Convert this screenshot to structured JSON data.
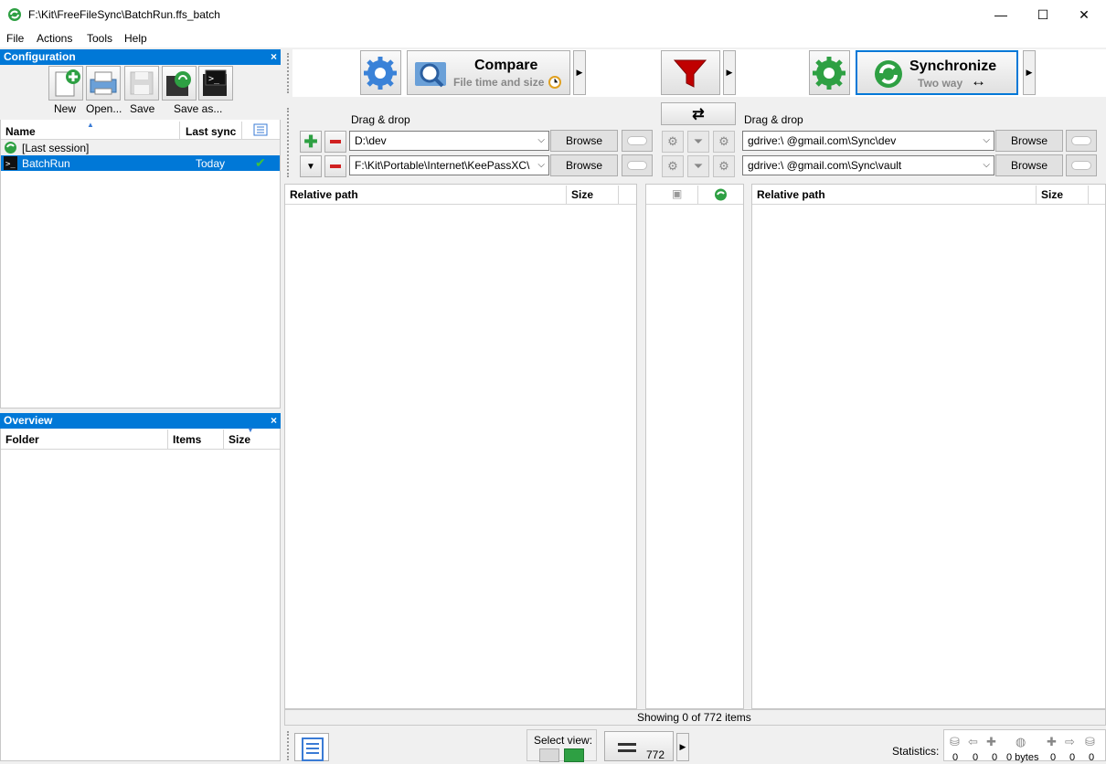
{
  "window": {
    "title": "F:\\Kit\\FreeFileSync\\BatchRun.ffs_batch",
    "minimize": "—",
    "maximize": "☐",
    "close": "✕"
  },
  "menu": [
    "File",
    "Actions",
    "Tools",
    "Help"
  ],
  "config_panel": {
    "title": "Configuration",
    "close": "×",
    "tools": [
      {
        "label": "New",
        "icon": "new-doc-icon"
      },
      {
        "label": "Open...",
        "icon": "open-printer-icon"
      },
      {
        "label": "Save",
        "icon": "save-disk-icon"
      },
      {
        "label": "Save as...",
        "icon": "save-as-icon"
      }
    ],
    "columns": {
      "name": "Name",
      "last_sync": "Last sync"
    },
    "rows": [
      {
        "name": "[Last session]",
        "last_sync": ""
      },
      {
        "name": "BatchRun",
        "last_sync": "Today"
      }
    ]
  },
  "overview_panel": {
    "title": "Overview",
    "close": "×",
    "columns": {
      "folder": "Folder",
      "items": "Items",
      "size": "Size"
    }
  },
  "toolbar": {
    "compare": {
      "label": "Compare",
      "sub": "File time and size"
    },
    "sync": {
      "label": "Synchronize",
      "sub": "Two way",
      "sub_icon": "↔"
    }
  },
  "folders": {
    "drag_left": "Drag & drop",
    "drag_right": "Drag & drop",
    "left": [
      "D:\\dev",
      "F:\\Kit\\Portable\\Internet\\KeePassXC\\"
    ],
    "right": [
      "gdrive:\\                    @gmail.com\\Sync\\dev",
      "gdrive:\\                    @gmail.com\\Sync\\vault"
    ],
    "browse": "Browse"
  },
  "grid": {
    "left_path": "Relative path",
    "left_size": "Size",
    "right_path": "Relative path",
    "right_size": "Size",
    "status": "Showing 0 of 772 items"
  },
  "bottom": {
    "select_view": "Select view:",
    "count": "772",
    "statistics": "Statistics:",
    "stats": [
      "0",
      "0",
      "0",
      "0 bytes",
      "0",
      "0",
      "0"
    ]
  },
  "colors": {
    "accent": "#0078d7",
    "selection": "#0078d7",
    "sync_green": "#2ea043",
    "filter_red": "#c00000"
  }
}
